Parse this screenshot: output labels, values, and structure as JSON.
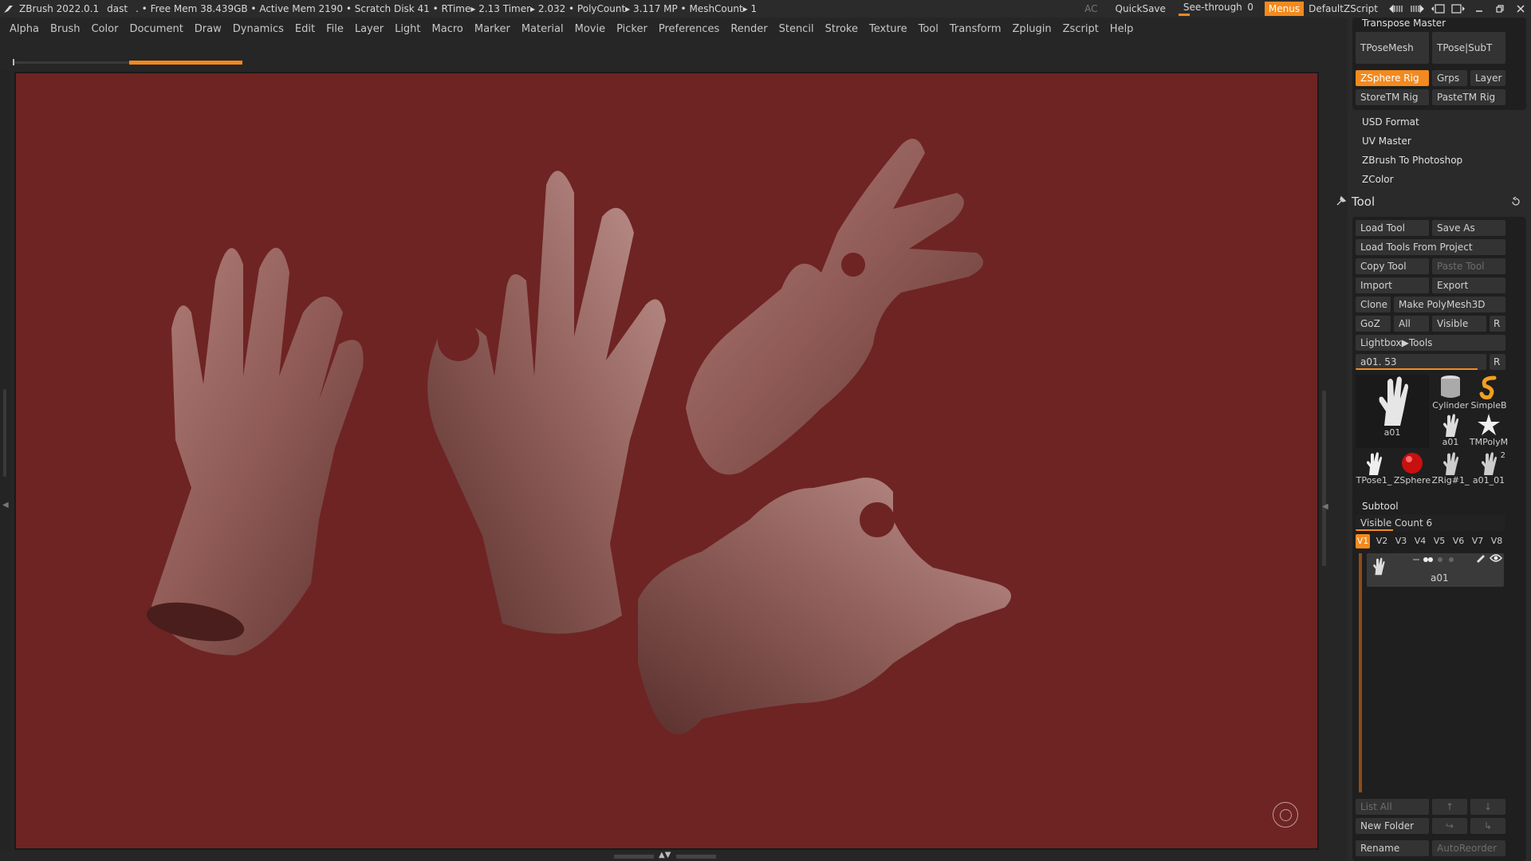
{
  "titlebar": {
    "app": "ZBrush 2022.0.1",
    "doc": "dast",
    "stats": ". • Free Mem 38.439GB • Active Mem 2190 • Scratch Disk 41 •  RTime▸ 2.13 Timer▸ 2.032 • PolyCount▸ 3.117 MP  • MeshCount▸ 1",
    "ac": "AC",
    "quicksave": "QuickSave",
    "seethrough_label": "See-through",
    "seethrough_value": "0",
    "menus": "Menus",
    "script": "DefaultZScript"
  },
  "menubar": [
    "Alpha",
    "Brush",
    "Color",
    "Document",
    "Draw",
    "Dynamics",
    "Edit",
    "File",
    "Layer",
    "Light",
    "Macro",
    "Marker",
    "Material",
    "Movie",
    "Picker",
    "Preferences",
    "Render",
    "Stencil",
    "Stroke",
    "Texture",
    "Tool",
    "Transform",
    "Zplugin",
    "Zscript",
    "Help"
  ],
  "panel": {
    "transpose_master": "Transpose Master",
    "tposemesh": "TPoseMesh",
    "tpose_subt": "TPose|SubT",
    "zsphere_rig": "ZSphere Rig",
    "grps": "Grps",
    "layer": "Layer",
    "storetm_rig": "StoreTM Rig",
    "pastetm_rig": "PasteTM Rig",
    "plugins": [
      "USD Format",
      "UV Master",
      "ZBrush To Photoshop",
      "ZColor"
    ],
    "tool_header": "Tool",
    "load_tool": "Load Tool",
    "save_as": "Save As",
    "load_from_project": "Load Tools From Project",
    "copy_tool": "Copy Tool",
    "paste_tool": "Paste Tool",
    "import": "Import",
    "export": "Export",
    "clone": "Clone",
    "make_polymesh": "Make PolyMesh3D",
    "goz": "GoZ",
    "all": "All",
    "visible": "Visible",
    "r": "R",
    "lightbox_tools": "Lightbox▶Tools",
    "tool_slider_label": "a01. 53",
    "slider_r": "R",
    "tool_slider_level": 0.93,
    "thumbs": {
      "main": "a01",
      "cylinder": "Cylinder",
      "simpleb": "SimpleB",
      "a01_small": "a01",
      "tmpoly": "TMPolyM",
      "tpose1": "TPose1_",
      "zsphere": "ZSphere",
      "zrig": "ZRig#1_",
      "a01_01": "a01_01",
      "a01_01_count": "2"
    },
    "subtool_header": "Subtool",
    "visible_count": "Visible Count 6",
    "visible_count_level": 0.25,
    "vtabs": [
      "V1",
      "V2",
      "V3",
      "V4",
      "V5",
      "V6",
      "V7",
      "V8"
    ],
    "subtool_item": "a01",
    "list_all": "List All",
    "new_folder": "New Folder",
    "rename": "Rename",
    "autoreorder": "AutoReorder"
  },
  "colors": {
    "accent": "#f28a1f",
    "canvas_bg": "#6e2423",
    "ui_bg": "#262626"
  }
}
